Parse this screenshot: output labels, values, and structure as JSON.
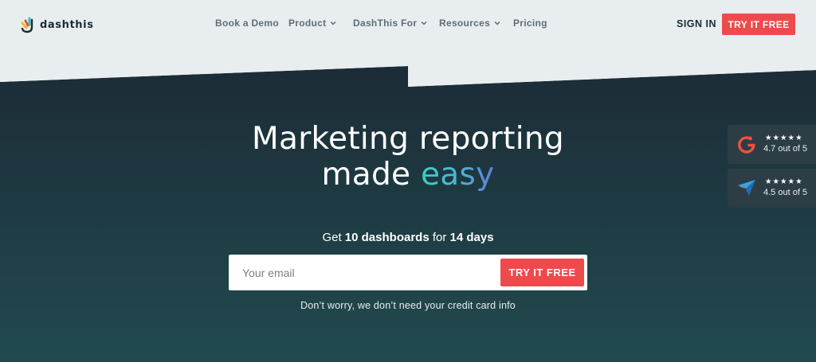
{
  "header": {
    "logo_text": "dashthis",
    "nav": [
      {
        "label": "Book a Demo",
        "dropdown": false
      },
      {
        "label": "Product",
        "dropdown": true
      },
      {
        "label": "DashThis For",
        "dropdown": true
      },
      {
        "label": "Resources",
        "dropdown": true
      },
      {
        "label": "Pricing",
        "dropdown": false
      }
    ],
    "sign_in": "SIGN IN",
    "cta": "TRY IT FREE"
  },
  "hero": {
    "headline_line1": "Marketing reporting",
    "headline_made": "made ",
    "headline_easy": "easy",
    "offer_get": "Get ",
    "offer_dashboards": "10 dashboards",
    "offer_for": " for ",
    "offer_days": "14 days",
    "email_placeholder": "Your email",
    "email_value": "",
    "cta": "TRY IT FREE",
    "disclaimer": "Don’t worry, we don’t need your credit card info"
  },
  "ratings": [
    {
      "icon": "g2-icon",
      "stars": "★★★★★",
      "score": "4.7 out of 5"
    },
    {
      "icon": "capterra-icon",
      "stars": "★★★★★",
      "score": "4.5 out of 5"
    }
  ],
  "colors": {
    "accent": "#ee4a4c",
    "hero_top": "#1e2f3a",
    "hero_bottom": "#204b4f",
    "header_bg": "#e8eef0"
  }
}
